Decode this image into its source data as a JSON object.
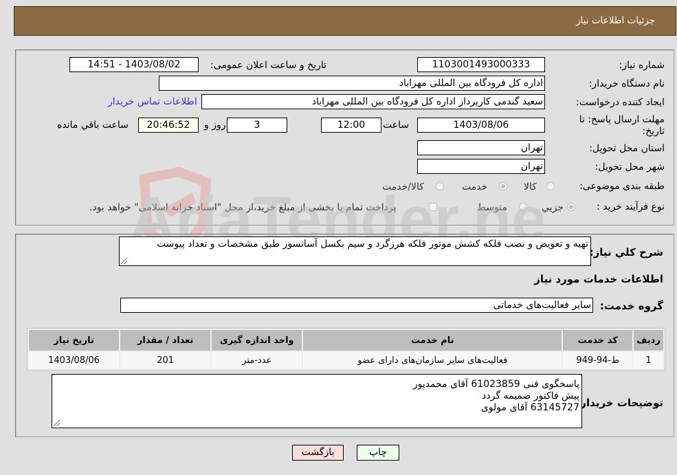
{
  "header": {
    "title": "جزئیات اطلاعات نیاز"
  },
  "form": {
    "need_number": {
      "label": "شماره نیاز:",
      "value": "1103001493000333"
    },
    "announce_datetime": {
      "label": "تاریخ و ساعت اعلان عمومی:",
      "value": "1403/08/02 - 14:51"
    },
    "buyer_org": {
      "label": "نام دستگاه خریدار:",
      "value": "اداره کل فرودگاه بین المللی مهراباد"
    },
    "requester": {
      "label": "ایجاد کننده درخواست:",
      "value": "سعید گندمی کارپرداز اداره کل فرودگاه بین المللی مهراباد"
    },
    "buyer_contact_link": "اطلاعات تماس خریدار",
    "deadline": {
      "label_line1": "مهلت ارسال پاسخ: تا",
      "label_line2": "تاریخ:",
      "date": "1403/08/06",
      "time_label": "ساعت",
      "time": "12:00",
      "days": "3",
      "days_label": "روز و",
      "remaining": "20:46:52",
      "remaining_label": "ساعت باقي مانده"
    },
    "delivery_province": {
      "label": "استان محل تحویل:",
      "value": "تهران"
    },
    "delivery_city": {
      "label": "شهر محل تحویل:",
      "value": "تهران"
    },
    "category": {
      "label": "طبقه بندی موضوعی:",
      "options": [
        "کالا",
        "خدمت",
        "کالا/خدمت"
      ],
      "selected": "خدمت"
    },
    "purchase_type": {
      "label": "نوع فرآیند خرید :",
      "options": [
        "جزيي",
        "متوسط"
      ],
      "selected": "جزيي",
      "treasury_checkbox_label": "پرداخت تمام یا بخشی از مبلغ خرید،از محل \"اسناد خزانه اسلامی\" خواهد بود."
    }
  },
  "details": {
    "description_label": "شرح کلي نياز:",
    "description": "تهیه و تعویض و نصب فلکه کشش موتور فلکه هرزگرد و سیم بکسل آسانسور طبق مشخصات و تعداد پیوست",
    "services_title": "اطلاعات خدمات مورد نیاز",
    "service_group_label": "گروه خدمت:",
    "service_group": "سایر فعالیت‌های خدماتی",
    "table": {
      "headers": [
        "ردیف",
        "کد خدمت",
        "نام خدمت",
        "واحد اندازه گیری",
        "تعداد / مقدار",
        "تاریخ نیاز"
      ],
      "rows": [
        [
          "1",
          "ط-94-949",
          "فعالیت‌های سایر سازمان‌های دارای عضو",
          "عدد-متر",
          "201",
          "1403/08/06"
        ]
      ]
    },
    "buyer_notes_label": "توضیحات خریدار:",
    "buyer_notes": [
      "پاسخگوی فنی 61023859 آقای محمدپور",
      "پیش فاکتور ضمیمه گردد",
      "63145727 آقای مولوی"
    ]
  },
  "buttons": {
    "print": "چاپ",
    "back": "بازگشت"
  },
  "watermark": {
    "text": "AriaTender.neT"
  }
}
